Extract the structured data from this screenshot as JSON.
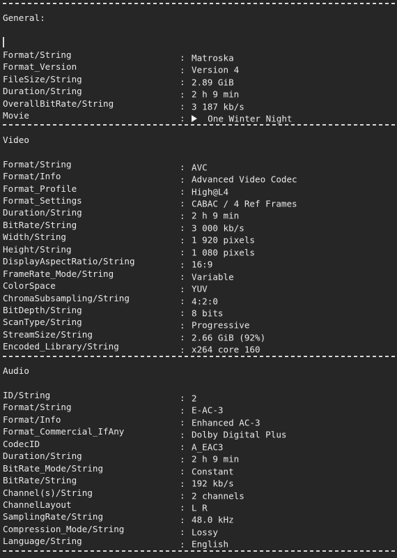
{
  "document": {
    "kind": "media-info-report",
    "background_color": "#262626",
    "text_color": "#e8e8e8",
    "separator_color": "#d8d8d8",
    "cursor_visible": true
  },
  "sections": [
    {
      "id": "general",
      "title": "General:",
      "has_cursor": true,
      "rows": [
        {
          "key": "Format/String",
          "colon": ":",
          "value": "Matroska"
        },
        {
          "key": "Format_Version",
          "colon": ":",
          "value": "Version 4"
        },
        {
          "key": "FileSize/String",
          "colon": ":",
          "value": "2.89 GiB"
        },
        {
          "key": "Duration/String",
          "colon": ":",
          "value": "2 h 9 min"
        },
        {
          "key": "OverallBitRate/String",
          "colon": ":",
          "value": "3 187 kb/s"
        },
        {
          "key": "Movie",
          "colon": ":",
          "value": "One Winter Night",
          "icon": "play-triangle-icon"
        }
      ]
    },
    {
      "id": "video",
      "title": "Video",
      "has_cursor": false,
      "rows": [
        {
          "key": "Format/String",
          "colon": ":",
          "value": "AVC"
        },
        {
          "key": "Format/Info",
          "colon": ":",
          "value": "Advanced Video Codec"
        },
        {
          "key": "Format_Profile",
          "colon": ":",
          "value": "High@L4"
        },
        {
          "key": "Format_Settings",
          "colon": ":",
          "value": "CABAC / 4 Ref Frames"
        },
        {
          "key": "Duration/String",
          "colon": ":",
          "value": "2 h 9 min"
        },
        {
          "key": "BitRate/String",
          "colon": ":",
          "value": "3 000 kb/s"
        },
        {
          "key": "Width/String",
          "colon": ":",
          "value": "1 920 pixels"
        },
        {
          "key": "Height/String",
          "colon": ":",
          "value": "1 080 pixels"
        },
        {
          "key": "DisplayAspectRatio/String",
          "colon": ":",
          "value": "16:9"
        },
        {
          "key": "FrameRate_Mode/String",
          "colon": ":",
          "value": "Variable"
        },
        {
          "key": "ColorSpace",
          "colon": ":",
          "value": "YUV"
        },
        {
          "key": "ChromaSubsampling/String",
          "colon": ":",
          "value": "4:2:0"
        },
        {
          "key": "BitDepth/String",
          "colon": ":",
          "value": "8 bits"
        },
        {
          "key": "ScanType/String",
          "colon": ":",
          "value": "Progressive"
        },
        {
          "key": "StreamSize/String",
          "colon": ":",
          "value": "2.66 GiB (92%)"
        },
        {
          "key": "Encoded_Library/String",
          "colon": ":",
          "value": "x264 core 160"
        }
      ]
    },
    {
      "id": "audio",
      "title": "Audio",
      "has_cursor": false,
      "rows": [
        {
          "key": "ID/String",
          "colon": ":",
          "value": "2"
        },
        {
          "key": "Format/String",
          "colon": ":",
          "value": "E-AC-3"
        },
        {
          "key": "Format/Info",
          "colon": ":",
          "value": "Enhanced AC-3"
        },
        {
          "key": "Format_Commercial_IfAny",
          "colon": ":",
          "value": "Dolby Digital Plus"
        },
        {
          "key": "CodecID",
          "colon": ":",
          "value": "A_EAC3"
        },
        {
          "key": "Duration/String",
          "colon": ":",
          "value": "2 h 9 min"
        },
        {
          "key": "BitRate_Mode/String",
          "colon": ":",
          "value": "Constant"
        },
        {
          "key": "BitRate/String",
          "colon": ":",
          "value": "192 kb/s"
        },
        {
          "key": "Channel(s)/String",
          "colon": ":",
          "value": "2 channels"
        },
        {
          "key": "ChannelLayout",
          "colon": ":",
          "value": "L R"
        },
        {
          "key": "SamplingRate/String",
          "colon": ":",
          "value": "48.0 kHz"
        },
        {
          "key": "Compression_Mode/String",
          "colon": ":",
          "value": "Lossy"
        },
        {
          "key": "Language/String",
          "colon": ":",
          "value": "English"
        }
      ]
    }
  ]
}
